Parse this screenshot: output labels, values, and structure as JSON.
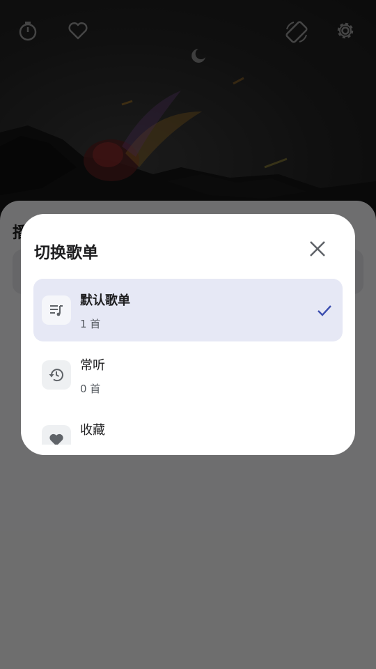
{
  "dialog": {
    "title": "切换歌单",
    "playlists": [
      {
        "name": "默认歌单",
        "count": "1 首",
        "icon": "playlist-music-icon",
        "selected": true
      },
      {
        "name": "常听",
        "count": "0 首",
        "icon": "history-icon",
        "selected": false
      },
      {
        "name": "收藏",
        "count": "",
        "icon": "heart-icon",
        "selected": false
      }
    ]
  },
  "sheet": {
    "title": "播"
  },
  "top_bar": {
    "icons": [
      "timer-icon",
      "heart-outline-icon",
      "screen-rotation-icon",
      "gear-icon"
    ]
  },
  "colors": {
    "accent": "#3d4fb0",
    "selected_bg": "#e6e8f5",
    "scrim": "rgba(0,0,0,0.55)"
  }
}
